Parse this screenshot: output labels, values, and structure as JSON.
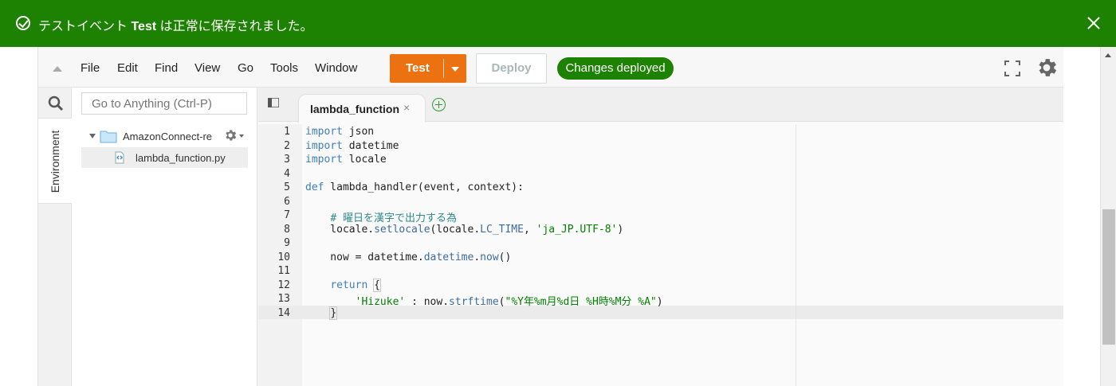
{
  "notification": {
    "prefix": "テストイベント ",
    "event_name": "Test",
    "suffix": " は正常に保存されました。"
  },
  "menu": {
    "items": [
      "File",
      "Edit",
      "Find",
      "View",
      "Go",
      "Tools",
      "Window"
    ]
  },
  "toolbar": {
    "test_label": "Test",
    "deploy_label": "Deploy",
    "status_badge": "Changes deployed"
  },
  "sidebar": {
    "environment_tab": "Environment",
    "goto_placeholder": "Go to Anything (Ctrl-P)",
    "folder_name": "AmazonConnect-res",
    "file_name": "lambda_function.py"
  },
  "editor": {
    "tab_label": "lambda_function",
    "tab_close": "×",
    "line_numbers": [
      "1",
      "2",
      "3",
      "4",
      "5",
      "6",
      "7",
      "8",
      "9",
      "10",
      "11",
      "12",
      "13",
      "14"
    ],
    "lines": [
      [
        {
          "t": "import",
          "c": "kw"
        },
        {
          "t": " json",
          "c": ""
        }
      ],
      [
        {
          "t": "import",
          "c": "kw"
        },
        {
          "t": " datetime",
          "c": ""
        }
      ],
      [
        {
          "t": "import",
          "c": "kw"
        },
        {
          "t": " locale",
          "c": ""
        }
      ],
      [],
      [
        {
          "t": "def",
          "c": "kw"
        },
        {
          "t": " lambda_handler(event, context):",
          "c": ""
        }
      ],
      [],
      [
        {
          "t": "    ",
          "c": ""
        },
        {
          "t": "# 曜日を漢字で出力する為",
          "c": "cm"
        }
      ],
      [
        {
          "t": "    locale.",
          "c": ""
        },
        {
          "t": "setlocale",
          "c": "fn"
        },
        {
          "t": "(locale.",
          "c": ""
        },
        {
          "t": "LC_TIME",
          "c": "fn"
        },
        {
          "t": ", ",
          "c": ""
        },
        {
          "t": "'ja_JP.UTF-8'",
          "c": "st"
        },
        {
          "t": ")",
          "c": ""
        }
      ],
      [],
      [
        {
          "t": "    now = datetime.",
          "c": ""
        },
        {
          "t": "datetime",
          "c": "fn"
        },
        {
          "t": ".",
          "c": ""
        },
        {
          "t": "now",
          "c": "fn"
        },
        {
          "t": "()",
          "c": ""
        }
      ],
      [],
      [
        {
          "t": "    ",
          "c": ""
        },
        {
          "t": "return",
          "c": "kw"
        },
        {
          "t": " ",
          "c": ""
        },
        {
          "t": "{",
          "c": "bkt"
        }
      ],
      [
        {
          "t": "        ",
          "c": ""
        },
        {
          "t": "'Hizuke'",
          "c": "st"
        },
        {
          "t": " : now.",
          "c": ""
        },
        {
          "t": "strftime",
          "c": "fn"
        },
        {
          "t": "(",
          "c": ""
        },
        {
          "t": "\"%Y年%m月%d日 %H時%M分 %A\"",
          "c": "st"
        },
        {
          "t": ")",
          "c": ""
        }
      ],
      [
        {
          "t": "    ",
          "c": ""
        },
        {
          "t": "}",
          "c": "bkt"
        }
      ]
    ]
  },
  "colors": {
    "banner": "#1d8102",
    "test_button": "#ec7211",
    "badge": "#1d8102"
  }
}
